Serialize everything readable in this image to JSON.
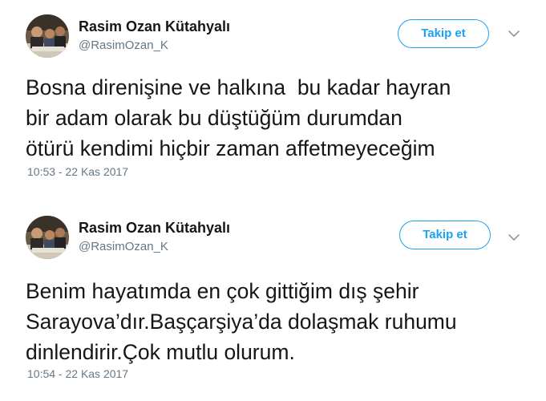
{
  "tweets": [
    {
      "author": {
        "display_name": "Rasim Ozan Kütahyalı",
        "handle": "@RasimOzan_K",
        "avatar_icon": "profile-photo"
      },
      "follow_label": "Takip et",
      "menu_icon": "chevron-down-icon",
      "text_lines": [
        "Bosna direnişine ve halkına  bu kadar hayran",
        "bir adam olarak bu düştüğüm durumdan",
        "ötürü kendimi hiçbir zaman affetmeyeceğim"
      ],
      "timestamp": "10:53 - 22 Kas 2017"
    },
    {
      "author": {
        "display_name": "Rasim Ozan Kütahyalı",
        "handle": "@RasimOzan_K",
        "avatar_icon": "profile-photo"
      },
      "follow_label": "Takip et",
      "menu_icon": "chevron-down-icon",
      "text_lines": [
        "Benim hayatımda en çok gittiğim dış şehir",
        "Sarayova’dır.Başçarşiya’da dolaşmak ruhumu",
        "dinlendirir.Çok mutlu olurum."
      ],
      "timestamp": "10:54 - 22 Kas 2017"
    }
  ],
  "colors": {
    "accent": "#1da1f2",
    "text": "#14171a",
    "secondary_text": "#657786",
    "background": "#ffffff"
  }
}
